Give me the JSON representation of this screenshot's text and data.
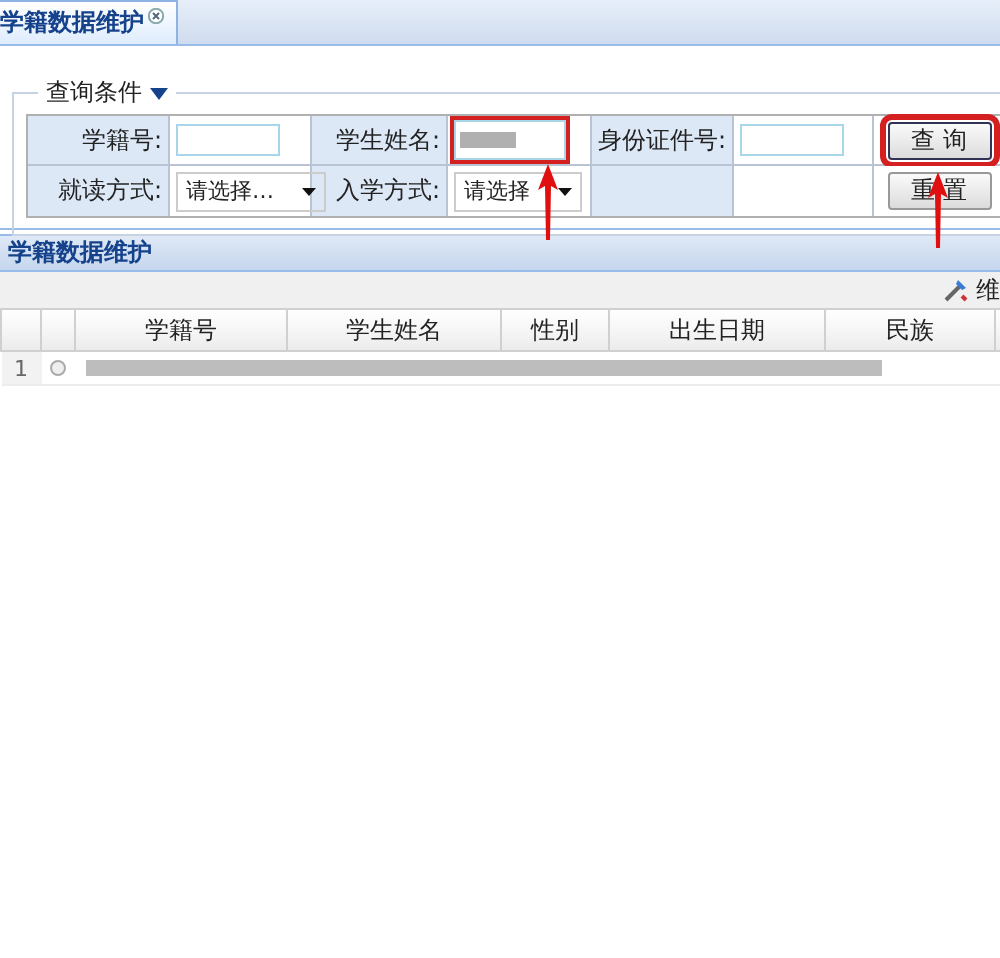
{
  "tab": {
    "label": "学籍数据维护",
    "selected": true
  },
  "query": {
    "legend": "查询条件",
    "expanded": true,
    "fields": [
      {
        "label": "学籍号:",
        "kind": "input",
        "highlighted": false,
        "redacted": false
      },
      {
        "label": "学生姓名:",
        "kind": "input",
        "highlighted": true,
        "redacted": true
      },
      {
        "label": "身份证件号:",
        "kind": "input",
        "highlighted": false,
        "redacted": false
      },
      {
        "label": "就读方式:",
        "kind": "select",
        "value": "请选择…"
      },
      {
        "label": "入学方式:",
        "kind": "select",
        "value": "请选择"
      }
    ],
    "buttons": [
      {
        "label": "查 询",
        "highlighted": true
      },
      {
        "label": "重 置",
        "highlighted": false
      }
    ]
  },
  "section": {
    "title": "学籍数据维护"
  },
  "toolbar": {
    "action": "维"
  },
  "table": {
    "columns": [
      "学籍号",
      "学生姓名",
      "性别",
      "出生日期",
      "民族"
    ],
    "rows": [
      {
        "number": "1",
        "selected": false,
        "redacted": true
      }
    ]
  }
}
